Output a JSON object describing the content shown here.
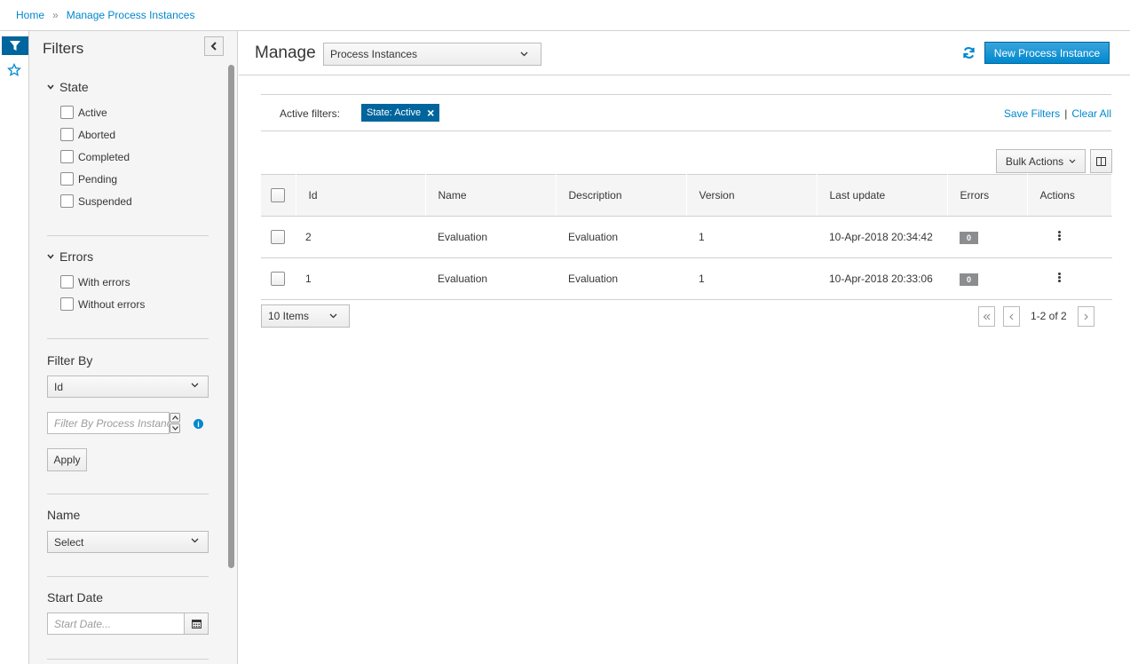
{
  "breadcrumb": {
    "home": "Home",
    "separator": "»",
    "current": "Manage Process Instances"
  },
  "filters": {
    "title": "Filters",
    "state": {
      "heading": "State",
      "options": [
        "Active",
        "Aborted",
        "Completed",
        "Pending",
        "Suspended"
      ]
    },
    "errors": {
      "heading": "Errors",
      "options": [
        "With errors",
        "Without errors"
      ]
    },
    "filter_by": {
      "heading": "Filter By",
      "selected": "Id",
      "placeholder": "Filter By Process Instance Id",
      "apply": "Apply"
    },
    "name": {
      "heading": "Name",
      "selected": "Select"
    },
    "start_date": {
      "heading": "Start Date",
      "placeholder": "Start Date..."
    }
  },
  "main": {
    "manage_label": "Manage",
    "view_select": "Process Instances",
    "new_button": "New Process Instance",
    "active_filters_label": "Active filters:",
    "chip": "State: Active",
    "save_filters": "Save Filters",
    "pipe": "|",
    "clear_all": "Clear All",
    "bulk_actions": "Bulk Actions",
    "columns": [
      "Id",
      "Name",
      "Description",
      "Version",
      "Last update",
      "Errors",
      "Actions"
    ],
    "rows": [
      {
        "id": "2",
        "name": "Evaluation",
        "description": "Evaluation",
        "version": "1",
        "last_update": "10-Apr-2018 20:34:42",
        "errors": "0"
      },
      {
        "id": "1",
        "name": "Evaluation",
        "description": "Evaluation",
        "version": "1",
        "last_update": "10-Apr-2018 20:33:06",
        "errors": "0"
      }
    ],
    "items_per_page": "10 Items",
    "pager_text": "1-2 of 2"
  },
  "colors": {
    "accent": "#0088ce",
    "dark_accent": "#00659c",
    "panel_bg": "#f5f5f5",
    "badge": "#8b8d8f"
  }
}
